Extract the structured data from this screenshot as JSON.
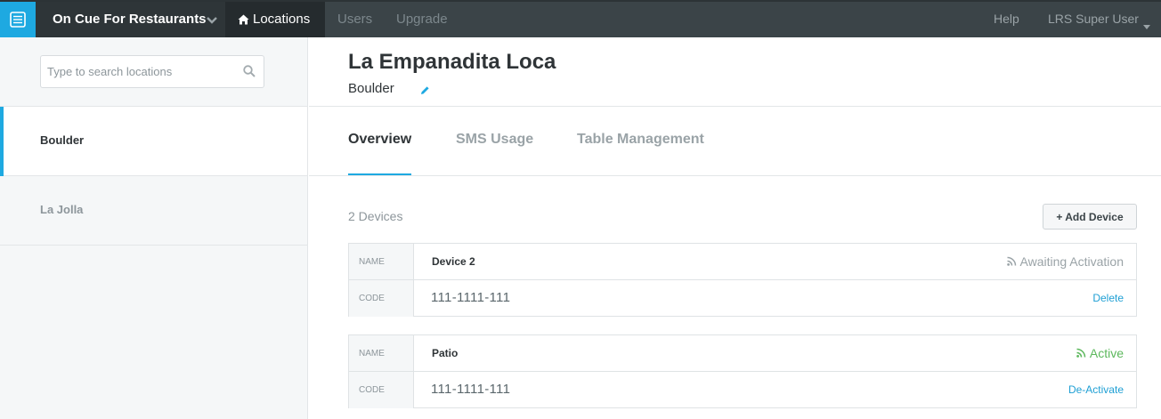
{
  "topbar": {
    "brand": "On Cue For Restaurants",
    "nav": [
      {
        "label": "Locations"
      },
      {
        "label": "Users"
      },
      {
        "label": "Upgrade"
      }
    ],
    "help": "Help",
    "user": "LRS Super User"
  },
  "sidebar": {
    "search_placeholder": "Type to search locations",
    "locations": [
      {
        "label": "Boulder",
        "selected": true
      },
      {
        "label": "La Jolla",
        "selected": false
      }
    ]
  },
  "header": {
    "title": "La Empanadita Loca",
    "subtitle": "Boulder"
  },
  "tabs": [
    {
      "label": "Overview",
      "active": true
    },
    {
      "label": "SMS Usage",
      "active": false
    },
    {
      "label": "Table Management",
      "active": false
    }
  ],
  "devices": {
    "count_label": "2 Devices",
    "add_button": "+ Add Device",
    "name_label": "NAME",
    "code_label": "CODE",
    "items": [
      {
        "name": "Device 2",
        "code": "111-1111-111",
        "status": "Awaiting Activation",
        "action": "Delete"
      },
      {
        "name": "Patio",
        "code": "111-1111-111",
        "status": "Active",
        "action": "De-Activate"
      }
    ]
  },
  "colors": {
    "accent": "#1ea9e1",
    "topbar": "#3b4448",
    "active_status": "#5cb85c",
    "link": "#1e9fd4"
  }
}
